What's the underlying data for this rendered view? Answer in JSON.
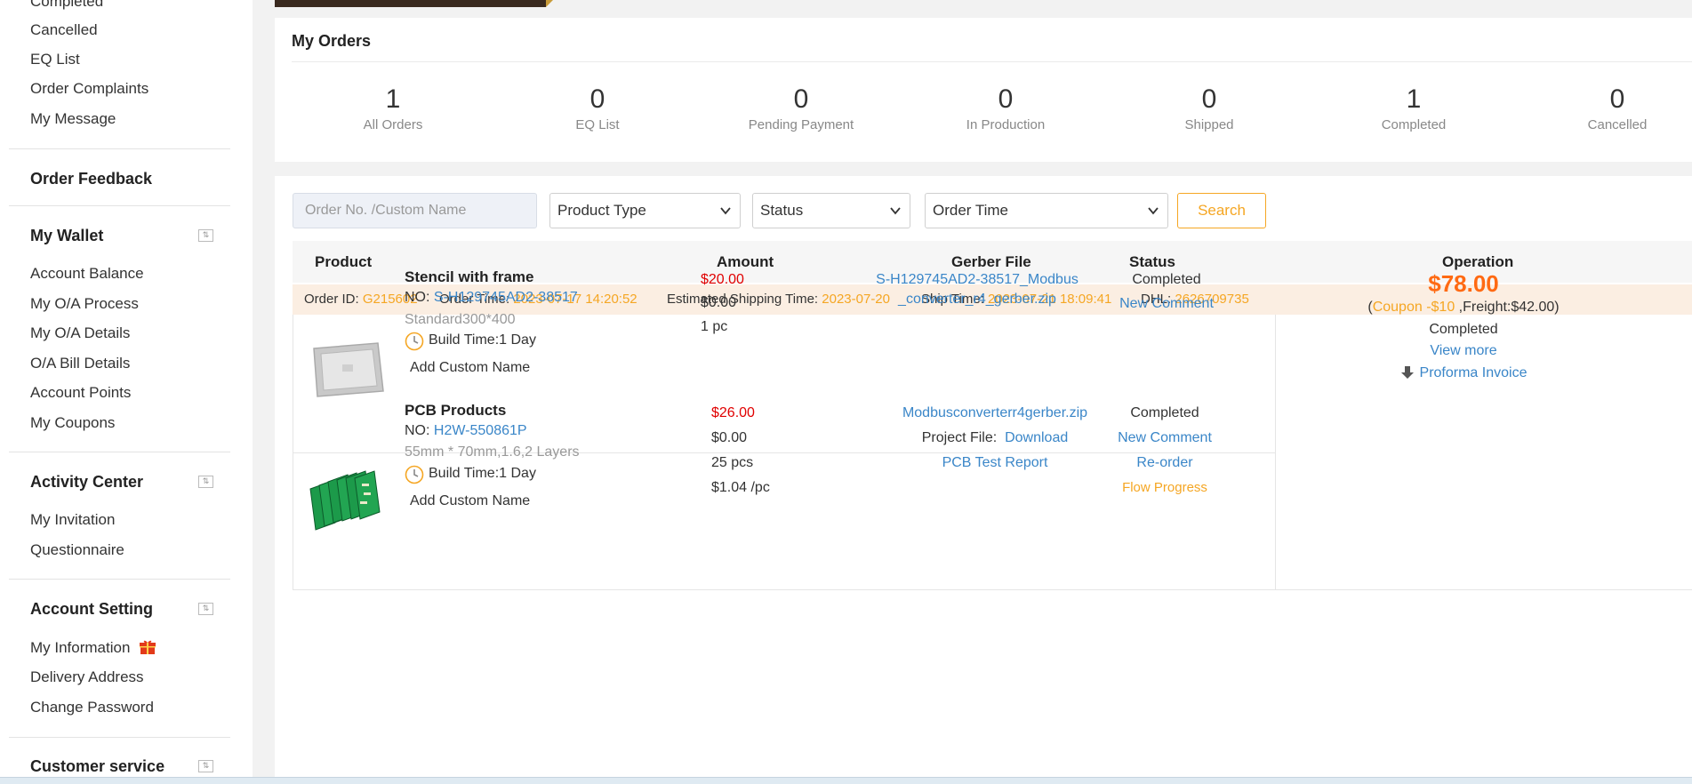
{
  "sidebar": {
    "items_top": [
      "Completed",
      "Cancelled",
      "EQ List",
      "Order Complaints",
      "My Message"
    ],
    "order_feedback": "Order Feedback",
    "wallet": {
      "title": "My Wallet",
      "items": [
        "Account Balance",
        "My O/A Process",
        "My O/A Details",
        "O/A Bill Details",
        "Account Points",
        "My Coupons"
      ]
    },
    "activity": {
      "title": "Activity Center",
      "items": [
        "My Invitation",
        "Questionnaire"
      ]
    },
    "account": {
      "title": "Account Setting",
      "items": [
        "My Information",
        "Delivery Address",
        "Change Password"
      ]
    },
    "customer_service": "Customer service"
  },
  "my_orders": {
    "title": "My Orders",
    "stats": [
      {
        "num": "1",
        "label": "All Orders"
      },
      {
        "num": "0",
        "label": "EQ List"
      },
      {
        "num": "0",
        "label": "Pending Payment"
      },
      {
        "num": "0",
        "label": "In Production"
      },
      {
        "num": "0",
        "label": "Shipped"
      },
      {
        "num": "1",
        "label": "Completed"
      },
      {
        "num": "0",
        "label": "Cancelled"
      }
    ]
  },
  "filters": {
    "search_placeholder": "Order No. /Custom Name",
    "product_type": "Product Type",
    "status": "Status",
    "order_time": "Order Time",
    "search_button": "Search"
  },
  "table": {
    "headers": {
      "product": "Product",
      "amount": "Amount",
      "gerber": "Gerber File",
      "status": "Status",
      "operation": "Operation"
    }
  },
  "order": {
    "id_label": "Order ID:",
    "id": "G215602",
    "time_label": "Order Time:",
    "time": "2023-07-17 14:20:52",
    "est_label": "Estimated Shipping Time:",
    "est": "2023-07-20",
    "ship_label": "Ship Time:",
    "ship": "2023-07-21 18:09:41",
    "dhl_label": "DHL:",
    "dhl": "2626709735",
    "items": [
      {
        "name": "Stencil with frame",
        "no_label": "NO:",
        "no": "S-H129745AD2-38517",
        "spec": "Standard300*400",
        "build": "Build Time:1 Day",
        "custom": "Add Custom Name",
        "price": "$20.00",
        "extra": "$0.00",
        "qty": "1 pc",
        "gerber_line1": "S-H129745AD2-38517_Modbus",
        "gerber_line2": "_converter_r4_gerber.zip",
        "status": "Completed",
        "comment": "New Comment"
      },
      {
        "name": "PCB Products",
        "no_label": "NO:",
        "no": "H2W-550861P",
        "spec": "55mm * 70mm,1.6,2 Layers",
        "build": "Build Time:1 Day",
        "custom": "Add Custom Name",
        "price": "$26.00",
        "extra": "$0.00",
        "qty": "25 pcs",
        "unit": "$1.04 /pc",
        "gerber": "Modbusconverterr4gerber.zip",
        "project_label": "Project File:",
        "project_link": "Download",
        "test_report": "PCB Test Report",
        "status": "Completed",
        "comment": "New Comment",
        "reorder": "Re-order",
        "flow": "Flow Progress"
      }
    ],
    "operation": {
      "total": "$78.00",
      "open_paren": "(",
      "coupon": "Coupon -$10",
      "freight": " ,Freight:$42.00)",
      "status": "Completed",
      "view_more": "View more",
      "invoice": "Proforma Invoice"
    }
  },
  "colors": {
    "accent": "#f5a623",
    "link": "#3a86c8",
    "price_red": "#e00000",
    "total_orange": "#ff6a13"
  }
}
